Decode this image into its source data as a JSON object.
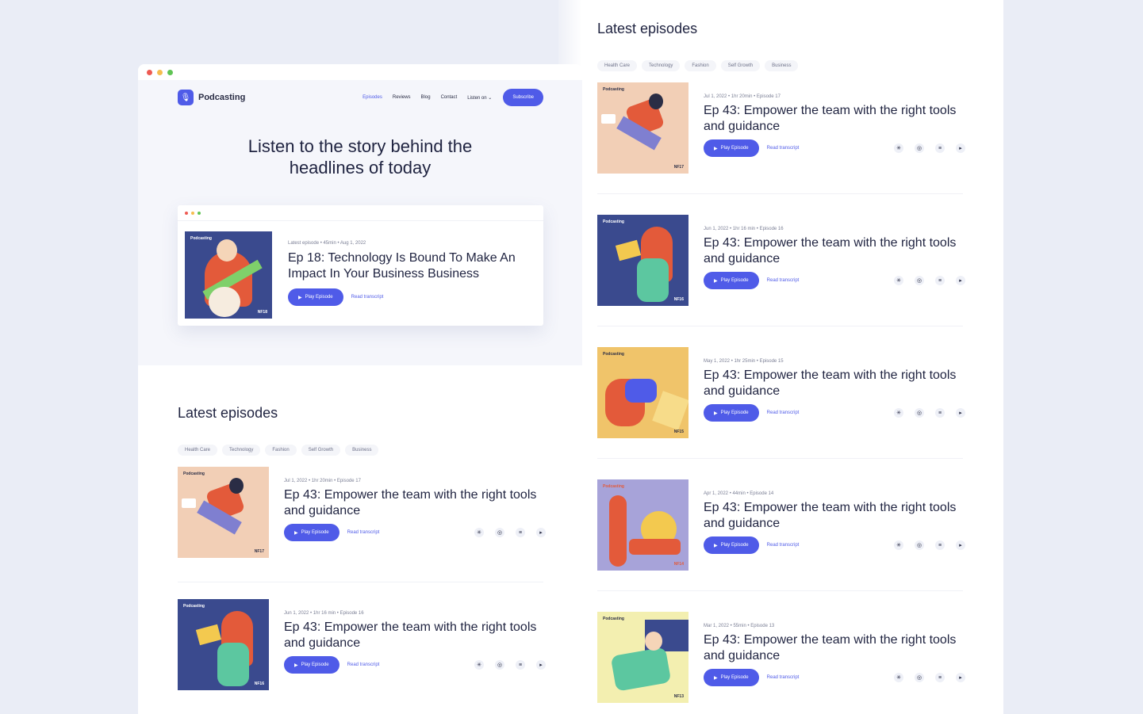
{
  "colors": {
    "accent": "#4f5be8",
    "text": "#1f2340",
    "muted": "#7b7f95"
  },
  "nav": {
    "brand": "Podcasting",
    "links": [
      "Episodes",
      "Reviews",
      "Blog",
      "Contact",
      "Listen on"
    ],
    "subscribe": "Subscribe"
  },
  "hero": {
    "title": "Listen to the story behind the headlines of today"
  },
  "featured": {
    "meta": "Latest episode • 45min • Aug 1, 2022",
    "title": "Ep 18: Technology Is Bound To Make An Impact In Your Business Business",
    "play": "Play Episode",
    "read": "Read transcript",
    "art_label": "Podcasting",
    "art_code": "NF18"
  },
  "section_title": "Latest episodes",
  "tags": [
    "Health Care",
    "Technology",
    "Fashion",
    "Self Growth",
    "Business"
  ],
  "episodes": [
    {
      "meta": "Jul 1, 2022 • 1hr 20min • Episode 17",
      "title": "Ep 43: Empower the team with the right tools and guidance",
      "code": "NF17",
      "art_label": "Podcasting",
      "play": "Play Episode",
      "read": "Read transcript",
      "bg": "#f2cfb6"
    },
    {
      "meta": "Jun 1, 2022 • 1hr 16 min • Episode 16",
      "title": "Ep 43: Empower the team with the right tools and guidance",
      "code": "NF16",
      "art_label": "Podcasting",
      "play": "Play Episode",
      "read": "Read transcript",
      "bg": "#3a4a8e"
    },
    {
      "meta": "May 1, 2022 • 1hr 25min • Episode 15",
      "title": "Ep 43: Empower the team with the right tools and guidance",
      "code": "NF15",
      "art_label": "Podcasting",
      "play": "Play Episode",
      "read": "Read transcript",
      "bg": "#f0c46a"
    },
    {
      "meta": "Apr 1, 2022 • 44min • Episode 14",
      "title": "Ep 43: Empower the team with the right tools and guidance",
      "code": "NF14",
      "art_label": "Podcasting",
      "play": "Play Episode",
      "read": "Read transcript",
      "bg": "#a7a3d9"
    },
    {
      "meta": "Mar 1, 2022 • 55min • Episode 13",
      "title": "Ep 43: Empower the team with the right tools and guidance",
      "code": "NF13",
      "art_label": "Podcasting",
      "play": "Play Episode",
      "read": "Read transcript",
      "bg": "#f3efb0"
    }
  ],
  "platforms": [
    "podcasts-icon",
    "apple-podcasts-icon",
    "spotify-icon",
    "youtube-icon"
  ]
}
